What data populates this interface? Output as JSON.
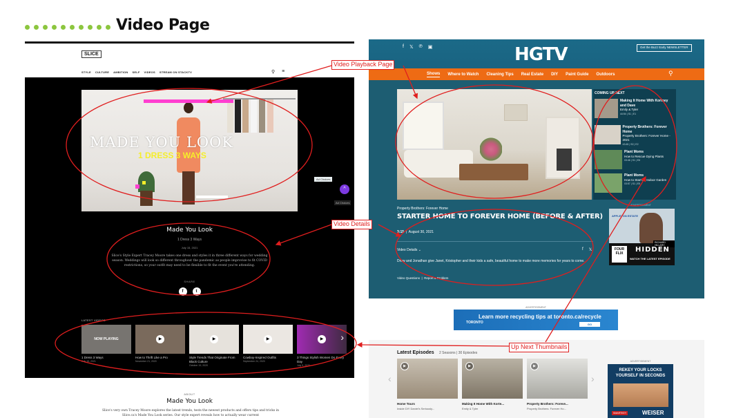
{
  "page_title": "Video Page",
  "slice": {
    "logo": "SLICE",
    "nav": [
      "STYLE",
      "CULTURE",
      "AMBITION",
      "SELF",
      "VIDEOS",
      "STREAM ON STACKTV"
    ],
    "video_title_line1": "MADE YOU LOOK",
    "video_title_line2": "1 DRESS 3 WAYS",
    "ad_choices": "Ad Choices",
    "details": {
      "title": "Made You Look",
      "subtitle": "1 Dress 3 Ways",
      "date": "July 15, 2021",
      "body": "Slice's Style Expert Tracey Moore takes one dress and styles it in three different ways for wedding season. Weddings will look so different throughout the pandemic as people improvise to fit COVID restrictions, so your outfit may need to be flexible to fit the event you're attending.",
      "share": "SHARE"
    },
    "latest_label": "LATEST VIDEOS",
    "now_playing": "NOW PLAYING",
    "thumbs": [
      {
        "caption": "1 Dress 3 Ways",
        "date": "July 15, 2021"
      },
      {
        "caption": "How to Thrift Like a Pro",
        "date": "November 21, 2020"
      },
      {
        "caption": "Style Trends That Originate From Black Culture",
        "date": "October 19, 2020"
      },
      {
        "caption": "Cowboy-Inspired Outfits",
        "date": "September 24, 2020"
      },
      {
        "caption": "3 Things Stylish Women Do Every Day",
        "date": "July 9, 2020"
      }
    ],
    "about_label": "ABOUT",
    "about_title": "Made You Look",
    "about_body": "Slice's very own Tracey Moore explores the latest trends, tests the newest products and offers tips and tricks in Slice.ca's Made You Look series. Our style expert reveals how to actually wear current"
  },
  "hgtv": {
    "logo": "HGTV",
    "newsletter": "Get the Buzz Early NEWSLETTER",
    "nav": [
      "Shows",
      "Where to Watch",
      "Cleaning Tips",
      "Real Estate",
      "DIY",
      "Paint Guide",
      "Outdoors"
    ],
    "up_next_header": "COMING UP NEXT",
    "up_next": [
      {
        "title": "Making It Home With Kortney and Dave",
        "sub": "Emily & Tyler",
        "meta": "44:54 | S1 | E1"
      },
      {
        "title": "Property Brothers: Forever Home",
        "sub": "Property Brothers: Forever Home - 2021",
        "meta": "43:45 | S2 | E2"
      },
      {
        "title": "Plant Moms",
        "sub": "How to Rescue Dying Plants",
        "meta": "03:46 | S1 | E6"
      },
      {
        "title": "Plant Moms",
        "sub": "How to Start an Indoor Garden",
        "meta": "03:57 | S1 | E5"
      }
    ],
    "show_name": "Property Brothers: Forever Home",
    "episode_title": "STARTER HOME TO FOREVER HOME (BEFORE & AFTER)",
    "duration": "3:15",
    "date": "August 30, 2021",
    "video_details": "Video Details",
    "description": "Drew and Jonathan give Janet, Kristopher and their kids a safe, beautiful home to make more memories for years to come.",
    "video_questions": "Video Questions",
    "report": "Report a Problem",
    "ad_label": "ADVERTISEMENT",
    "ad_hidden": "HIDDEN",
    "ad_watch": "WATCH THE LATEST EPISODE",
    "ad_badge": "APPLETON ESTATE",
    "ad_name": "RICHARD HILLARY",
    "ad_logo": "FOUR FLIX",
    "ad_choices": "Ad Choices"
  },
  "toronto_ad": {
    "label": "ADVERTISEMENT",
    "text": "Learn more recycling tips at toronto.ca/recycle",
    "logo": "TORONTO",
    "button": "GO"
  },
  "latest": {
    "title": "Latest Episodes",
    "meta": "2 Seasons | 30 Episodes",
    "episodes": [
      {
        "title": "Home Tours",
        "sub": "Inside DIY Daniel's Seriously..."
      },
      {
        "title": "Making It Home With Korte...",
        "sub": "Emily & Tyler"
      },
      {
        "title": "Property Brothers: Foreve...",
        "sub": "Property Brothers: Forever Ho..."
      }
    ]
  },
  "rekey_ad": {
    "label": "ADVERTISEMENT",
    "headline": "REKEY YOUR LOCKS YOURSELF IN SECONDS",
    "brand": "WEISER",
    "tag": "SMARTKEY"
  },
  "annotations": {
    "playback": "Video Playback Page",
    "details": "Video Details",
    "up_next": "Up Next Thumbnails"
  },
  "colors": {
    "accent_green": "#8cc63f",
    "annotation_red": "#e01e1e",
    "hgtv_teal": "#1d5d72",
    "hgtv_orange": "#ee6b14",
    "slice_pink": "#ff3fd0"
  }
}
